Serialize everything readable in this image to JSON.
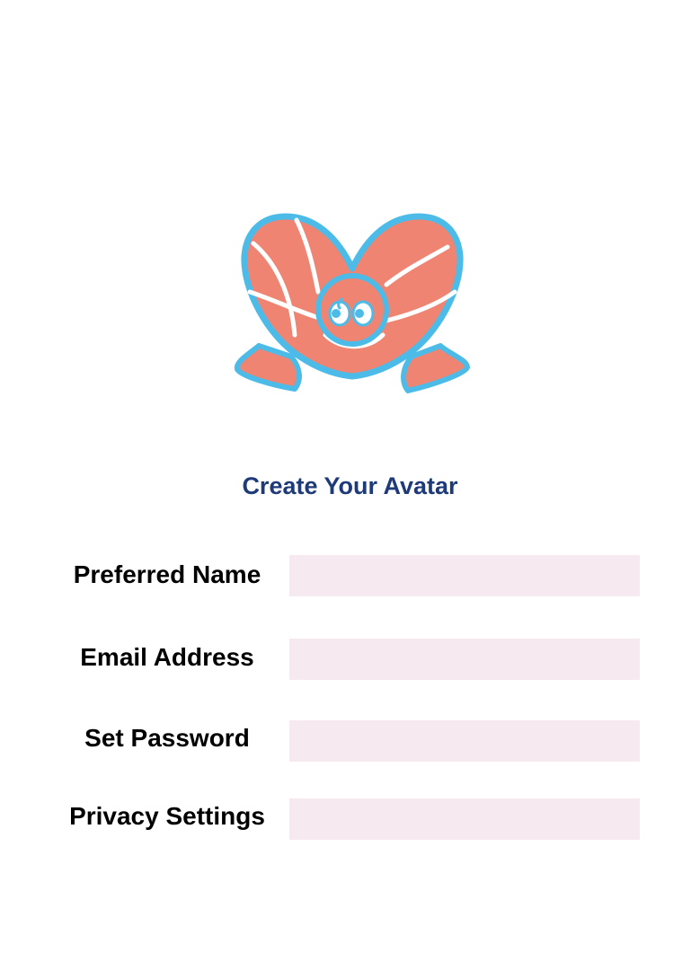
{
  "app": {
    "title": "Create Your Avatar",
    "colors": {
      "title": "#1e3a78",
      "field_background": "#f6eaf0",
      "mascot_body": "#ef8472",
      "mascot_outline": "#4cbbe8"
    }
  },
  "logo": {
    "icon": "heart-mascot-icon"
  },
  "form": {
    "fields": [
      {
        "label": "Preferred Name",
        "value": "",
        "placeholder": ""
      },
      {
        "label": "Email Address",
        "value": "",
        "placeholder": ""
      },
      {
        "label": "Set Password",
        "value": "",
        "placeholder": ""
      },
      {
        "label": "Privacy Settings",
        "value": "",
        "placeholder": ""
      }
    ]
  }
}
